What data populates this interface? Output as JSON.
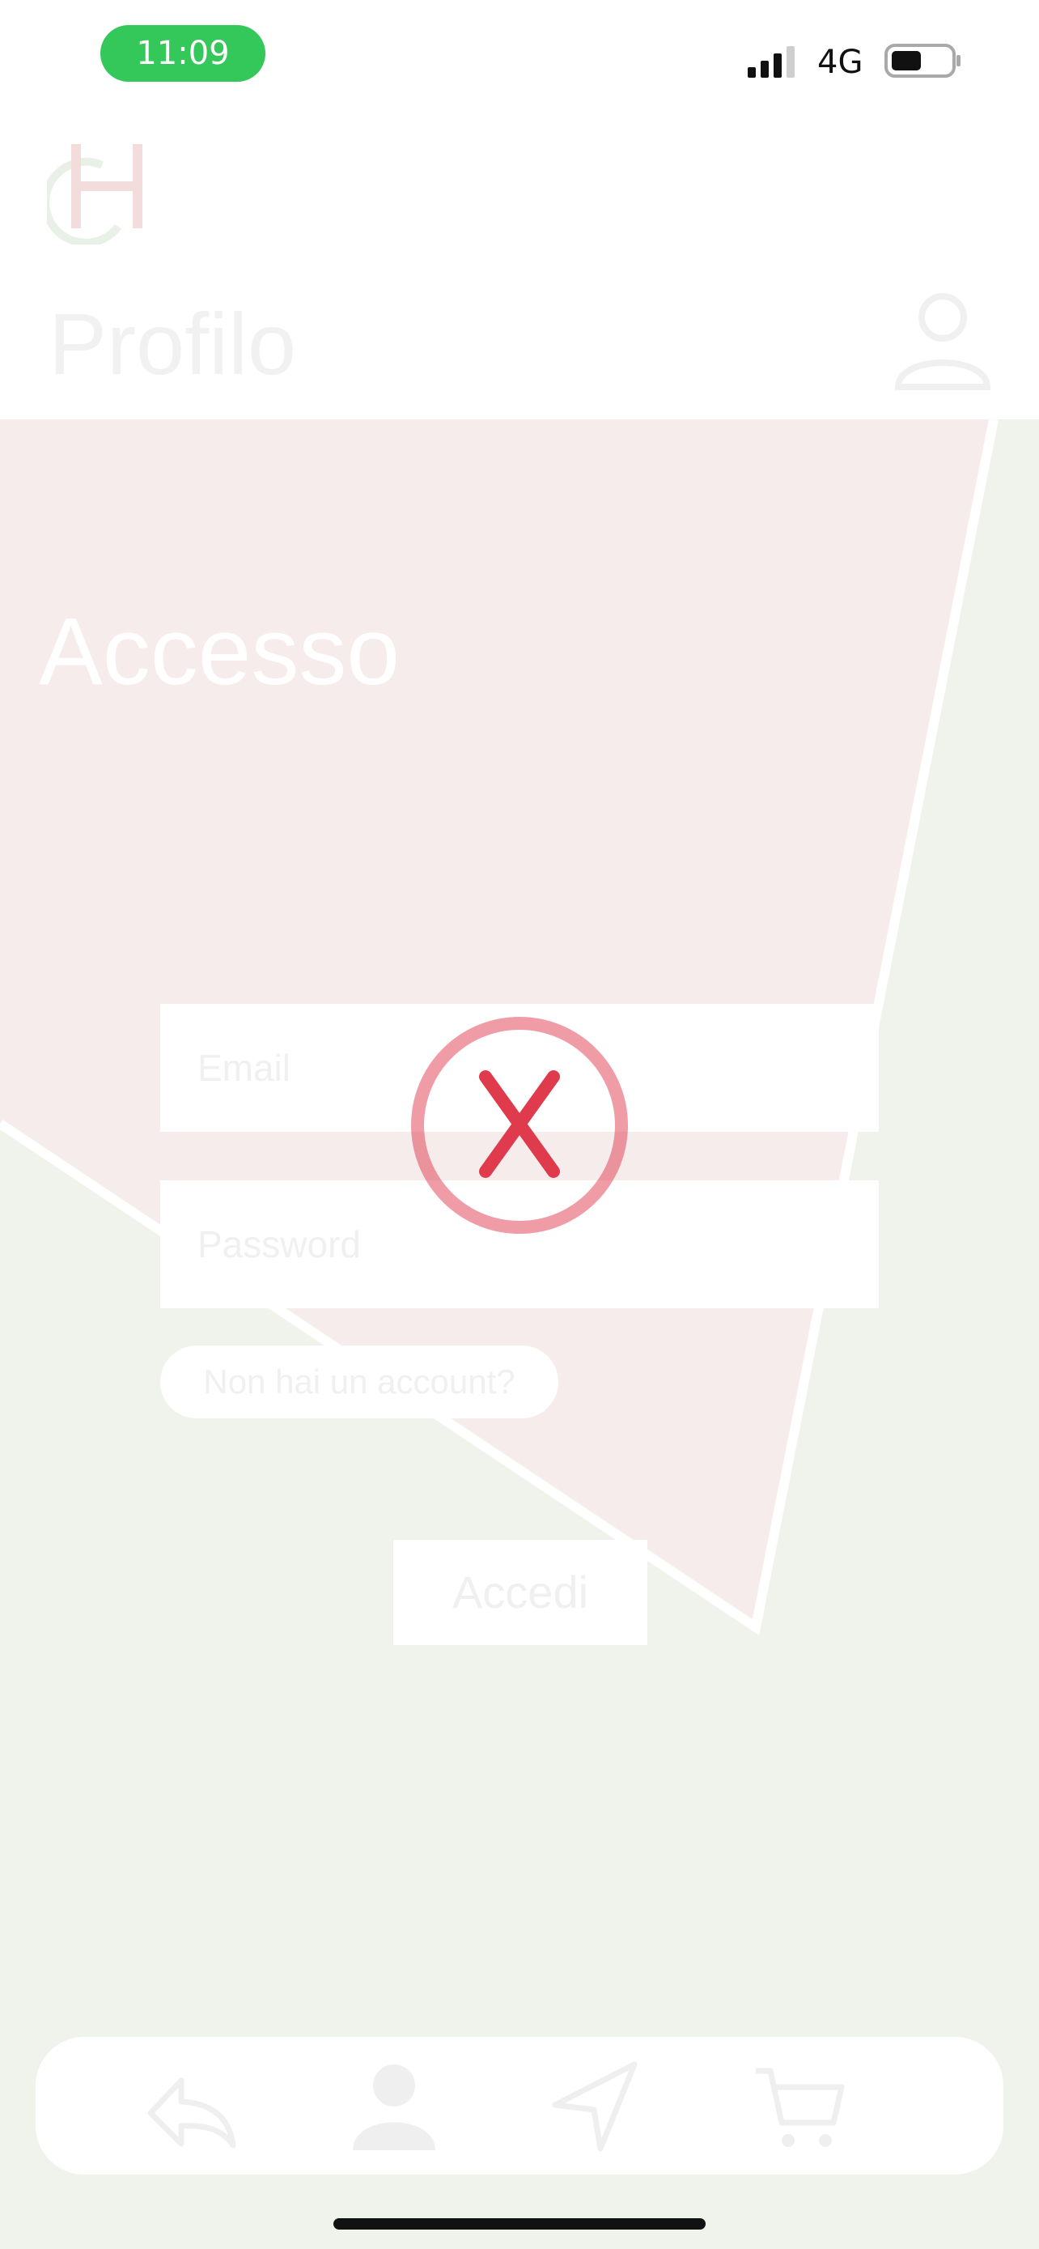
{
  "status_bar": {
    "time": "11:09",
    "network": "4G",
    "signal_icon": "cellular-signal-icon",
    "battery_icon": "battery-icon"
  },
  "header": {
    "logo_icon": "gh-logo-icon",
    "title": "Profilo",
    "profile_icon": "user-outline-icon"
  },
  "login": {
    "section_title": "Accesso",
    "email_placeholder": "Email",
    "password_placeholder": "Password",
    "signup_link": "Non hai un account?",
    "login_button": "Accedi"
  },
  "overlay": {
    "icon": "error-x-icon",
    "color": "#e03a4d"
  },
  "tab_bar": {
    "items": [
      {
        "icon": "back-arrow-icon"
      },
      {
        "icon": "user-filled-icon"
      },
      {
        "icon": "navigation-arrow-icon"
      },
      {
        "icon": "cart-icon"
      }
    ]
  },
  "colors": {
    "page_bg": "#eff3ec",
    "shape_fill": "#f5eceb",
    "status_pill": "#34c759",
    "error": "#e03a4d"
  }
}
